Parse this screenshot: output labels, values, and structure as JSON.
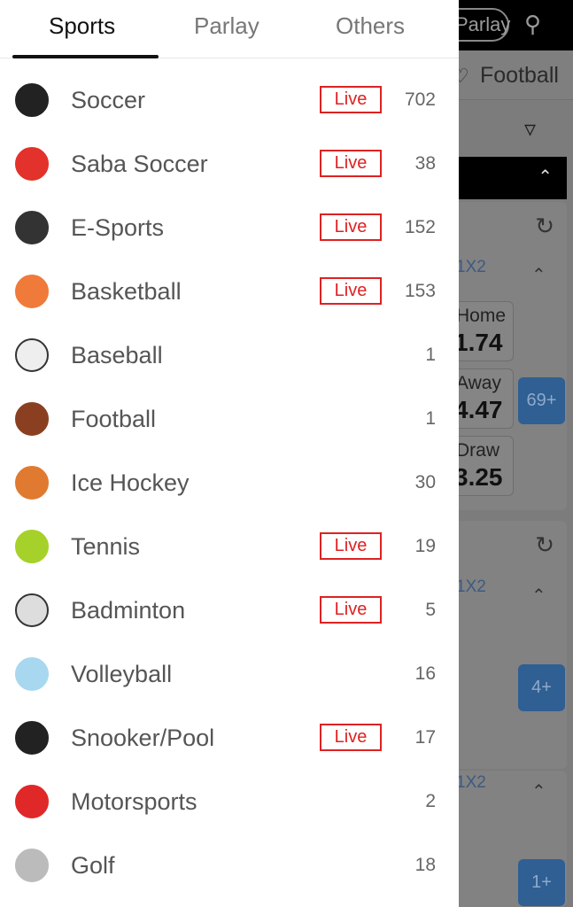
{
  "background": {
    "parlay_button": "Parlay",
    "sport_label": "Football",
    "markets": [
      "1X2",
      "1X2",
      "1X2"
    ],
    "odds": [
      {
        "label": "Home",
        "value": "1.74"
      },
      {
        "label": "Away",
        "value": "4.47"
      },
      {
        "label": "Draw",
        "value": "3.25"
      }
    ],
    "more_buttons": [
      "69+",
      "4+",
      "1+"
    ]
  },
  "tabs": [
    {
      "label": "Sports",
      "active": true
    },
    {
      "label": "Parlay"
    },
    {
      "label": "Others"
    }
  ],
  "live_label": "Live",
  "accent": "#dd2222",
  "sports": [
    {
      "name": "Soccer",
      "live": true,
      "count": "702",
      "icon": "soccer-ball-icon",
      "color": "#222"
    },
    {
      "name": "Saba Soccer",
      "live": true,
      "count": "38",
      "icon": "saba-soccer-icon",
      "color": "#e2322b"
    },
    {
      "name": "E-Sports",
      "live": true,
      "count": "152",
      "icon": "headset-icon",
      "color": "#333"
    },
    {
      "name": "Basketball",
      "live": true,
      "count": "153",
      "icon": "basketball-icon",
      "color": "#f07a3a"
    },
    {
      "name": "Baseball",
      "live": false,
      "count": "1",
      "icon": "baseball-icon",
      "color": "#eeeeee"
    },
    {
      "name": "Football",
      "live": false,
      "count": "1",
      "icon": "american-football-icon",
      "color": "#8a4020"
    },
    {
      "name": "Ice Hockey",
      "live": false,
      "count": "30",
      "icon": "ice-hockey-icon",
      "color": "#e07a30"
    },
    {
      "name": "Tennis",
      "live": true,
      "count": "19",
      "icon": "tennis-ball-icon",
      "color": "#a5d12a"
    },
    {
      "name": "Badminton",
      "live": true,
      "count": "5",
      "icon": "shuttlecock-icon",
      "color": "#dddddd"
    },
    {
      "name": "Volleyball",
      "live": false,
      "count": "16",
      "icon": "volleyball-icon",
      "color": "#a8d8f0"
    },
    {
      "name": "Snooker/Pool",
      "live": true,
      "count": "17",
      "icon": "eight-ball-icon",
      "color": "#222"
    },
    {
      "name": "Motorsports",
      "live": false,
      "count": "2",
      "icon": "racing-helmet-icon",
      "color": "#e02828"
    },
    {
      "name": "Golf",
      "live": false,
      "count": "18",
      "icon": "golf-ball-icon",
      "color": "#bbbbbb"
    }
  ]
}
